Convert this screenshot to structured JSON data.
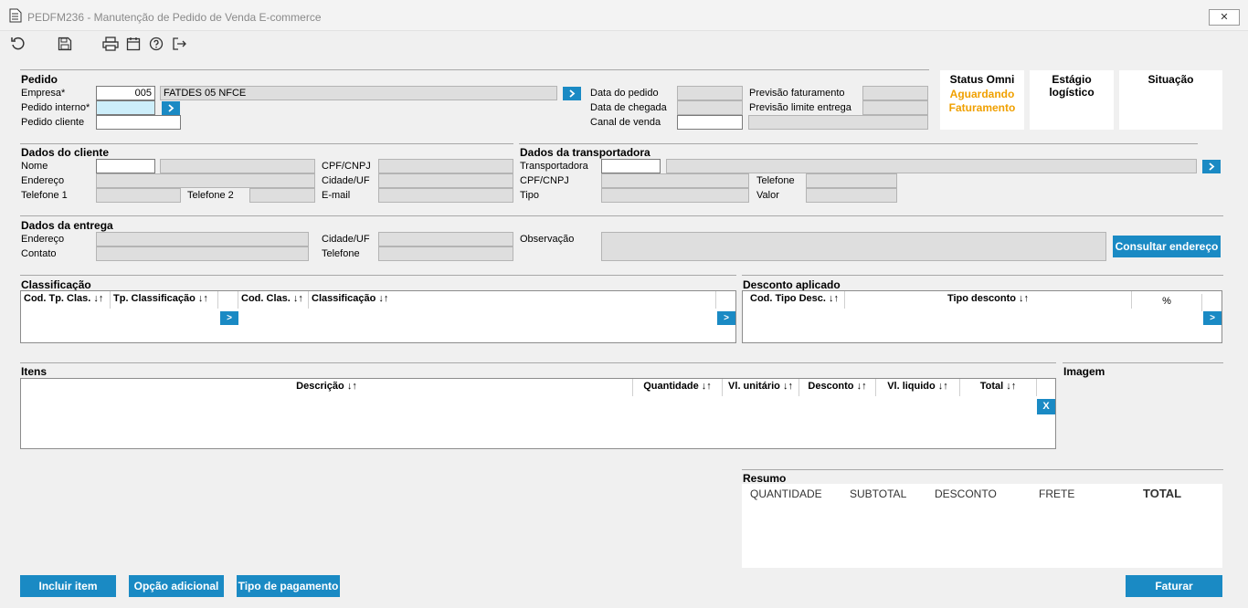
{
  "window": {
    "title": "PEDFM236 - Manutenção de Pedido de Venda E-commerce",
    "close_glyph": "✕"
  },
  "pedido": {
    "title": "Pedido",
    "empresa_label": "Empresa*",
    "empresa_code": "005",
    "empresa_name": "FATDES 05 NFCE",
    "pedido_interno_label": "Pedido interno*",
    "pedido_cliente_label": "Pedido cliente",
    "data_pedido_label": "Data do pedido",
    "data_chegada_label": "Data de chegada",
    "canal_venda_label": "Canal de venda",
    "previsao_fat_label": "Previsão faturamento",
    "previsao_limite_label": "Previsão limite entrega"
  },
  "status": {
    "omni_title": "Status Omni",
    "omni_line1": "Aguardando",
    "omni_line2": "Faturamento",
    "estagio_title": "Estágio logístico",
    "situacao_title": "Situação",
    "omni_color": "#f0a000"
  },
  "cliente": {
    "title": "Dados do cliente",
    "nome": "Nome",
    "endereco": "Endereço",
    "telefone1": "Telefone 1",
    "telefone2": "Telefone 2",
    "cpf": "CPF/CNPJ",
    "cidade": "Cidade/UF",
    "email": "E-mail"
  },
  "transportadora": {
    "title": "Dados da transportadora",
    "transportadora": "Transportadora",
    "cpf": "CPF/CNPJ",
    "tipo": "Tipo",
    "telefone": "Telefone",
    "valor": "Valor"
  },
  "entrega": {
    "title": "Dados da entrega",
    "endereco": "Endereço",
    "contato": "Contato",
    "cidade": "Cidade/UF",
    "telefone": "Telefone",
    "observacao": "Observação",
    "consultar_button": "Consultar endereço"
  },
  "classificacao": {
    "title": "Classificação",
    "col1": "Cod. Tp. Clas. ↓↑",
    "col2": "Tp. Classificação ↓↑",
    "col3": "Cod. Clas. ↓↑",
    "col4": "Classificação ↓↑",
    "go": ">"
  },
  "desconto": {
    "title": "Desconto aplicado",
    "col1": "Cod. Tipo Desc. ↓↑",
    "col2": "Tipo desconto ↓↑",
    "col3": "%",
    "go": ">"
  },
  "itens": {
    "title": "Itens",
    "col1": "Descrição ↓↑",
    "col2": "Quantidade ↓↑",
    "col3": "Vl. unitário ↓↑",
    "col4": "Desconto ↓↑",
    "col5": "Vl. liquido ↓↑",
    "col6": "Total ↓↑",
    "remove": "X"
  },
  "imagem": {
    "title": "Imagem"
  },
  "resumo": {
    "title": "Resumo",
    "quantidade": "QUANTIDADE",
    "subtotal": "SUBTOTAL",
    "desconto": "DESCONTO",
    "frete": "FRETE",
    "total": "TOTAL"
  },
  "buttons": {
    "incluir": "Incluir item",
    "opcao": "Opção adicional",
    "tipo_pagamento": "Tipo de pagamento",
    "faturar": "Faturar"
  },
  "icons": [
    "document-icon",
    "refresh-icon",
    "save-icon",
    "print-icon",
    "calendar-icon",
    "help-icon",
    "exit-icon"
  ]
}
